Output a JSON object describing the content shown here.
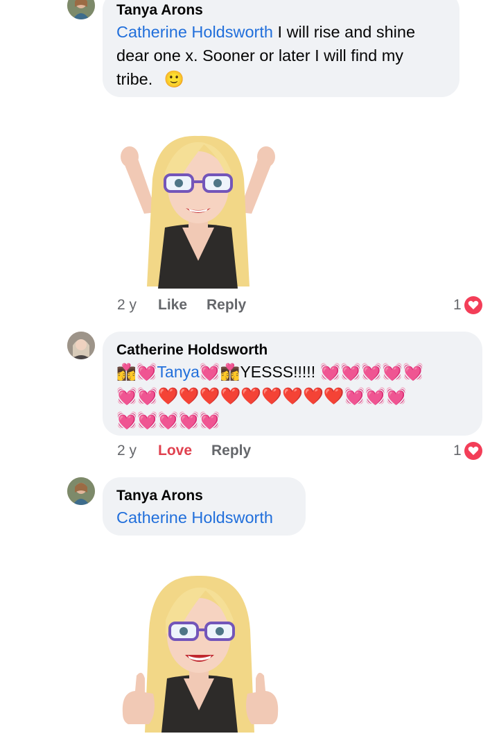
{
  "comments": [
    {
      "author": "Tanya Arons",
      "mention": "Catherine Holdsworth",
      "text_line1": " I will rise and shine",
      "text_line2": "dear one x. Sooner or later I will find my",
      "text_line3": "tribe.",
      "emoji": "🙂",
      "time": "2 y",
      "action1": "Like",
      "action2": "Reply",
      "reaction_count": "1"
    },
    {
      "author": "Catherine Holdsworth",
      "mention": "Tanya",
      "text": "YESSS!!!!!",
      "couple_emoji": "👩‍❤️‍💋‍👩",
      "pink_heart": "💓",
      "red_heart": "❤️",
      "time": "2 y",
      "action1": "Love",
      "action2": "Reply",
      "reaction_count": "1"
    },
    {
      "author": "Tanya Arons",
      "mention": "Catherine Holdsworth"
    }
  ],
  "colors": {
    "mention": "#216fdb",
    "love": "#e0414f",
    "bubble": "#f0f2f5",
    "meta": "#65676b",
    "heart_badge": "#f33e58"
  }
}
